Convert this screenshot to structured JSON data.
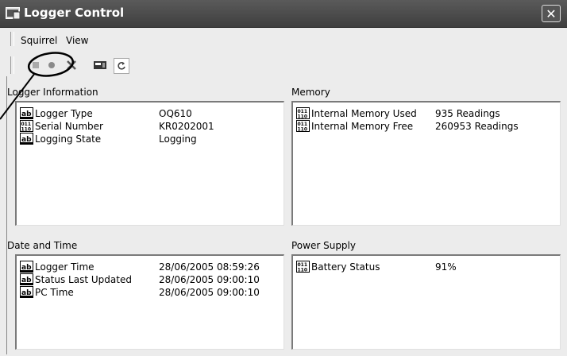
{
  "window": {
    "title": "Logger Control",
    "close_glyph": "✕"
  },
  "menu": {
    "items": [
      "Squirrel",
      "View"
    ]
  },
  "toolbar": {
    "icons": [
      "stop-icon",
      "record-icon",
      "cancel-icon",
      "card-icon",
      "refresh-icon"
    ]
  },
  "panels": {
    "logger_info": {
      "label": "Logger Information",
      "rows": [
        {
          "icon": "ab-icon",
          "key": "Logger Type",
          "value": "OQ610"
        },
        {
          "icon": "number-icon",
          "key": "Serial Number",
          "value": "KR0202001"
        },
        {
          "icon": "ab-icon",
          "key": "Logging State",
          "value": "Logging"
        }
      ]
    },
    "memory": {
      "label": "Memory",
      "rows": [
        {
          "icon": "number-icon",
          "key": "Internal Memory Used",
          "value": "935 Readings"
        },
        {
          "icon": "number-icon",
          "key": "Internal Memory Free",
          "value": "260953 Readings"
        }
      ]
    },
    "date_time": {
      "label": "Date and Time",
      "rows": [
        {
          "icon": "ab-icon",
          "key": "Logger Time",
          "value": "28/06/2005 08:59:26"
        },
        {
          "icon": "ab-icon",
          "key": "Status Last Updated",
          "value": "28/06/2005 09:00:10"
        },
        {
          "icon": "ab-icon",
          "key": "PC Time",
          "value": "28/06/2005 09:00:10"
        }
      ]
    },
    "power": {
      "label": "Power Supply",
      "rows": [
        {
          "icon": "number-icon",
          "key": "Battery Status",
          "value": "91%"
        }
      ]
    }
  }
}
